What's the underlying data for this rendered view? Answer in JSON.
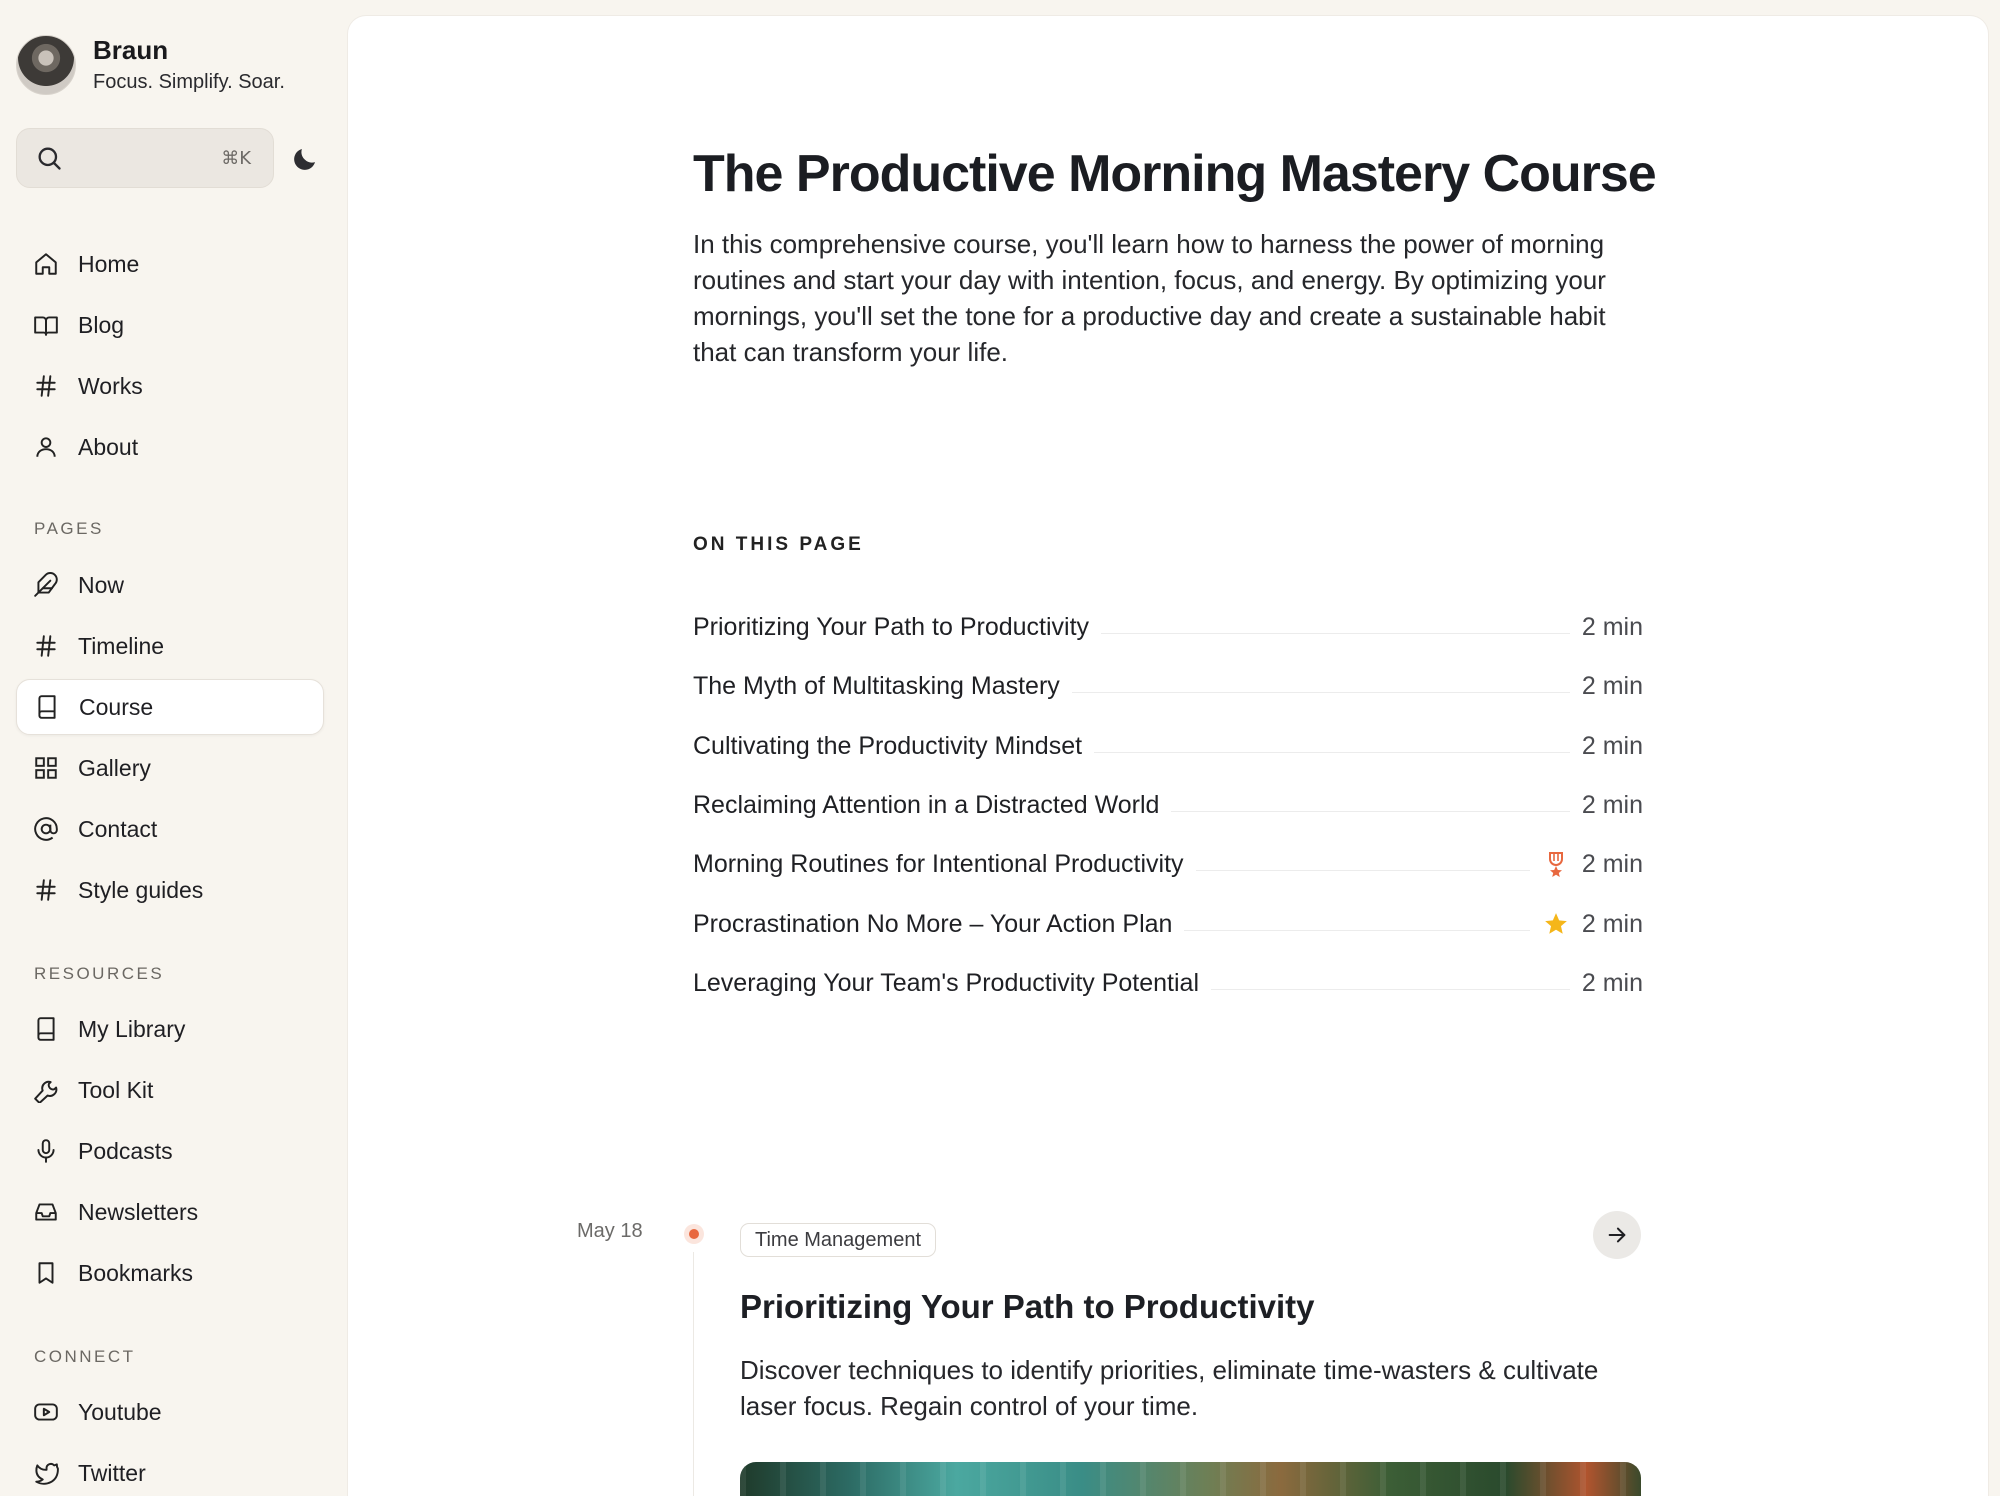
{
  "profile": {
    "name": "Braun",
    "tagline": "Focus. Simplify. Soar."
  },
  "search": {
    "shortcut": "⌘K"
  },
  "nav": {
    "home": "Home",
    "blog": "Blog",
    "works": "Works",
    "about": "About"
  },
  "pages": {
    "title": "PAGES",
    "now": "Now",
    "timeline": "Timeline",
    "course": "Course",
    "gallery": "Gallery",
    "contact": "Contact",
    "style_guides": "Style guides"
  },
  "resources": {
    "title": "RESOURCES",
    "library": "My Library",
    "toolkit": "Tool Kit",
    "podcasts": "Podcasts",
    "newsletters": "Newsletters",
    "bookmarks": "Bookmarks"
  },
  "connect": {
    "title": "CONNECT",
    "youtube": "Youtube",
    "twitter": "Twitter"
  },
  "main": {
    "title": "The Productive Morning Mastery Course",
    "intro": "In this comprehensive course, you'll learn how to harness the power of morning routines and start your day with intention, focus, and energy. By optimizing your mornings, you'll set the tone for a productive day and create a sustainable habit that can transform your life.",
    "toc_heading": "ON THIS PAGE",
    "toc": [
      {
        "title": "Prioritizing Your Path to Productivity",
        "time": "2 min",
        "badge": ""
      },
      {
        "title": "The Myth of Multitasking Mastery",
        "time": "2 min",
        "badge": ""
      },
      {
        "title": "Cultivating the Productivity Mindset",
        "time": "2 min",
        "badge": ""
      },
      {
        "title": "Reclaiming Attention in a Distracted World",
        "time": "2 min",
        "badge": ""
      },
      {
        "title": "Morning Routines for Intentional Productivity",
        "time": "2 min",
        "badge": "award-icon"
      },
      {
        "title": "Procrastination No More – Your Action Plan",
        "time": "2 min",
        "badge": "star-icon"
      },
      {
        "title": "Leveraging Your Team's Productivity Potential",
        "time": "2 min",
        "badge": ""
      }
    ]
  },
  "post": {
    "date": "May 18",
    "tag": "Time Management",
    "title": "Prioritizing Your Path to Productivity",
    "description": "Discover techniques to identify priorities, eliminate time-wasters & cultivate laser focus. Regain control of your time."
  },
  "colors": {
    "accent": "#e8683f",
    "star": "#f5b61a",
    "sidebar_bg": "#f8f5ef"
  }
}
